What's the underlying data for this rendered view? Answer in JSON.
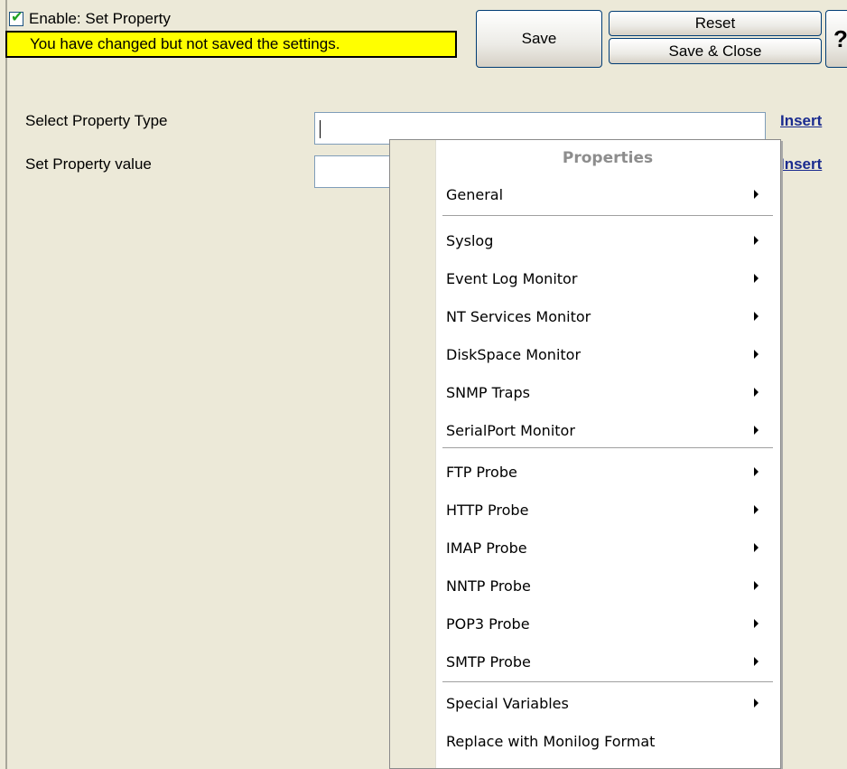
{
  "header": {
    "enable_label": "Enable: Set Property",
    "enable_checked": true,
    "warning": "You have changed but not saved the settings.",
    "save_label": "Save",
    "reset_label": "Reset",
    "save_close_label": "Save & Close",
    "help_label": "?"
  },
  "form": {
    "type_label": "Select Property Type",
    "type_value": "",
    "value_label": "Set Property value",
    "value_value": "",
    "insert_1": "Insert",
    "insert_2": "Insert"
  },
  "menu": {
    "title": "Properties",
    "items": [
      {
        "label": "General",
        "submenu": true
      },
      {
        "label": "Syslog",
        "submenu": true
      },
      {
        "label": "Event Log Monitor",
        "submenu": true
      },
      {
        "label": "NT Services Monitor",
        "submenu": true
      },
      {
        "label": "DiskSpace Monitor",
        "submenu": true
      },
      {
        "label": "SNMP Traps",
        "submenu": true
      },
      {
        "label": "SerialPort Monitor",
        "submenu": true
      },
      {
        "label": "FTP Probe",
        "submenu": true
      },
      {
        "label": "HTTP Probe",
        "submenu": true
      },
      {
        "label": "IMAP Probe",
        "submenu": true
      },
      {
        "label": "NNTP Probe",
        "submenu": true
      },
      {
        "label": "POP3 Probe",
        "submenu": true
      },
      {
        "label": "SMTP Probe",
        "submenu": true
      },
      {
        "label": "Special Variables",
        "submenu": true
      },
      {
        "label": "Replace with Monilog Format",
        "submenu": false
      }
    ]
  }
}
